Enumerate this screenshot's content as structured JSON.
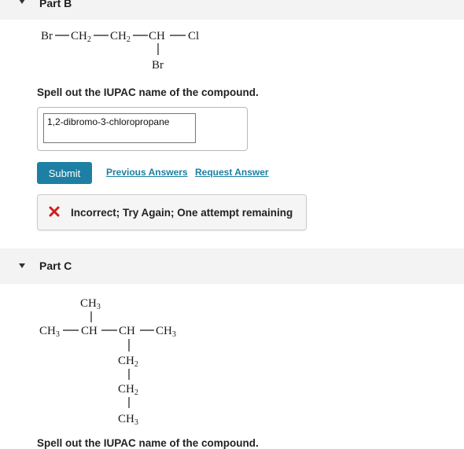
{
  "part_b": {
    "header": "Part B",
    "structure": {
      "br1": "Br",
      "ch2_a_main": "CH",
      "ch2_a_sub": "2",
      "ch2_b_main": "CH",
      "ch2_b_sub": "2",
      "ch": "CH",
      "cl": "Cl",
      "br2": "Br"
    },
    "question": "Spell out the IUPAC name of the compound.",
    "answer_value": "1,2-dibromo-3-chloropropane",
    "submit_label": "Submit",
    "previous_answers_label": "Previous Answers",
    "request_answer_label": "Request Answer",
    "feedback_text": "Incorrect; Try Again; One attempt remaining"
  },
  "part_c": {
    "header": "Part C",
    "structure": {
      "top_ch3_main": "CH",
      "top_ch3_sub": "3",
      "left_ch3_main": "CH",
      "left_ch3_sub": "3",
      "ch_1": "CH",
      "ch_2": "CH",
      "right_ch3_main": "CH",
      "right_ch3_sub": "3",
      "ch2_1_main": "CH",
      "ch2_1_sub": "2",
      "ch2_2_main": "CH",
      "ch2_2_sub": "2",
      "bottom_ch3_main": "CH",
      "bottom_ch3_sub": "3"
    },
    "question": "Spell out the IUPAC name of the compound."
  },
  "colors": {
    "accent": "#1d7fa3",
    "error": "#cc1f1f",
    "header_bg": "#f3f3f3"
  },
  "icons": {
    "caret": "caret-down-icon",
    "feedback": "x-mark-icon"
  }
}
